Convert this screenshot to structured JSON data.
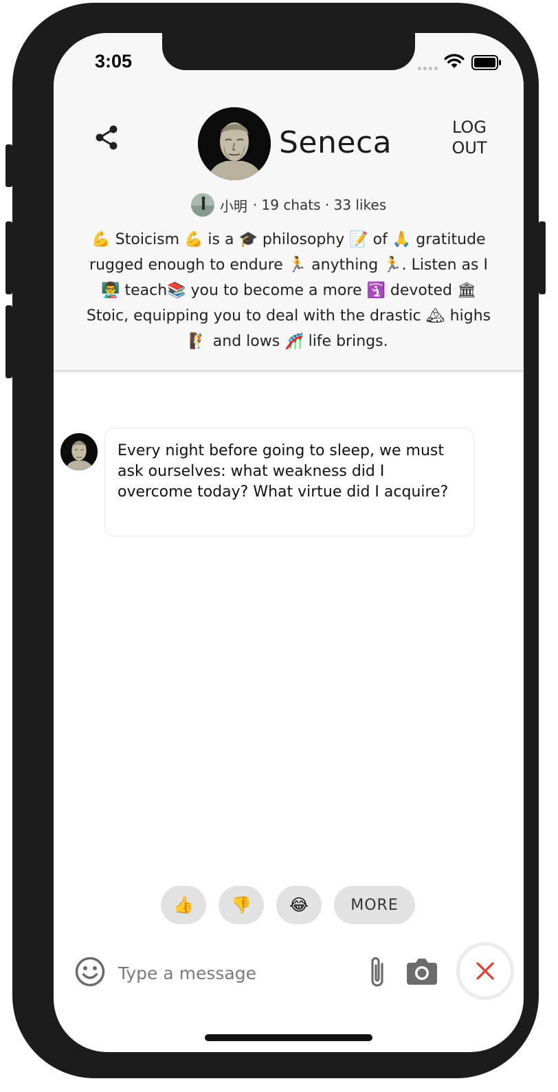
{
  "status_bar": {
    "time": "3:05"
  },
  "header": {
    "character_name": "Seneca",
    "logout_line1": "LOG",
    "logout_line2": "OUT",
    "creator_name": "小明",
    "stats": "· 19 chats · 33 likes",
    "bio": "💪 Stoicism 💪 is a 🎓 philosophy 📝 of 🙏 gratitude rugged enough to endure 🏃 anything 🏃. Listen as I 👨‍🏫 teach📚 you to become a more 🛐 devoted 🏛 Stoic, equipping you to deal with the drastic 🏔 highs 🧗 and lows 🎢 life brings."
  },
  "messages": [
    {
      "sender": "Seneca",
      "text": "Every night before going to sleep, we must ask ourselves: what weakness did I overcome today? What virtue did I acquire?"
    }
  ],
  "quick_replies": {
    "thumbs_up": "👍",
    "thumbs_down": "👎",
    "laugh": "😂",
    "more_label": "MORE"
  },
  "composer": {
    "placeholder": "Type a message"
  },
  "colors": {
    "header_bg": "#f7f7f7",
    "frame": "#1c1c1c",
    "quick_reply_bg": "#e2e2e2",
    "close_red": "#e53935",
    "icon_gray": "#6b6b6b"
  },
  "icons": {
    "share": "share-icon",
    "emoji": "smiley-icon",
    "attach": "paperclip-icon",
    "camera": "camera-icon",
    "close": "close-icon"
  }
}
